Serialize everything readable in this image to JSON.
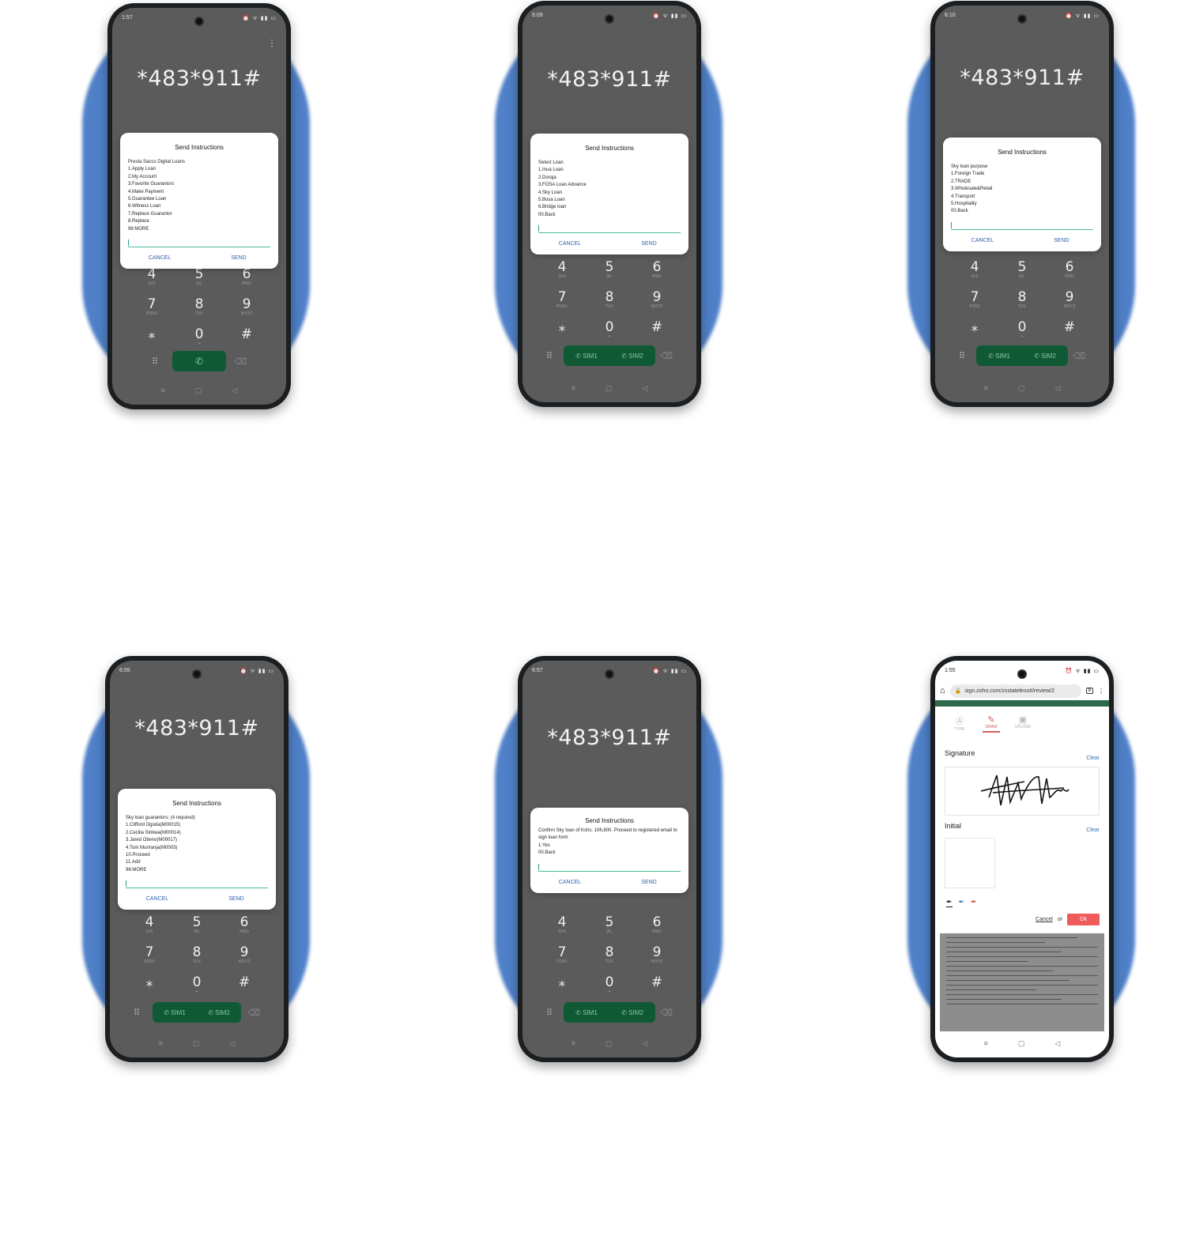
{
  "ussd_code": "*483*911#",
  "dialog_title": "Send Instructions",
  "cancel_label": "CANCEL",
  "send_label": "SEND",
  "sim1_label": "SIM1",
  "sim2_label": "SIM2",
  "keypad": [
    {
      "digit": "4",
      "letters": "GHI"
    },
    {
      "digit": "5",
      "letters": "JKL"
    },
    {
      "digit": "6",
      "letters": "MNO"
    },
    {
      "digit": "7",
      "letters": "PQRS"
    },
    {
      "digit": "8",
      "letters": "TUV"
    },
    {
      "digit": "9",
      "letters": "WXYZ"
    },
    {
      "digit": "⁎",
      "letters": ""
    },
    {
      "digit": "0",
      "letters": "+"
    },
    {
      "digit": "#",
      "letters": ""
    }
  ],
  "phones": [
    {
      "time": "1:57",
      "dialog_text": "Presta Sacco Digital Loans\n1.Apply Loan\n2.My Account\n3.Favorite Guarantors\n4.Make Payment\n5.Guarantee Loan\n6.Witness Loan\n7.Replace Guarantor\n8.Replace\n98:MORE"
    },
    {
      "time": "6:09",
      "dialog_text": "Select Loan\n1.Inua Loan\n2.Doraja\n3.FOSA Loan Advance\n4.Sky Loan\n5.Bosa Loan\n6.Bridge loan\n00.Back"
    },
    {
      "time": "6:10",
      "dialog_text": "Sky loan purpose\n1.Foreign Trade\n2.TRADE\n3.Wholesale&Retail\n4.Transport\n5.Hospitality\n00.Back"
    },
    {
      "time": "6:55",
      "dialog_text": "Sky loan guarantors: (4 required)\n1.Clifford Ogoda(M00015)\n2.Cecilia Sirikwa(M00014)\n3.Jared Otieno(M00017)\n4.Tom Muriranja(M0003)\n10.Proceed\n11.Add\n98:MORE"
    },
    {
      "time": "6:57",
      "dialog_text": "Confirm Sky loan of Kshs. 106,800. Proceed to registered email to sign loan form\n1.Yes\n00.Back"
    },
    {
      "time": "1:55",
      "url": "sign.zoho.com/zsstateless#/review/2",
      "tabs": [
        "TYPE",
        "DRAW",
        "UPLOAD"
      ],
      "signature_label": "Signature",
      "initial_label": "Initial",
      "clear_label": "Clear",
      "cancel_label": "Cancel",
      "or_label": "or",
      "ok_label": "Ok"
    }
  ],
  "colors": {
    "accent_blue": "#4f80c8",
    "call_green": "#0f5a34",
    "ok_red": "#ef5b5b"
  }
}
